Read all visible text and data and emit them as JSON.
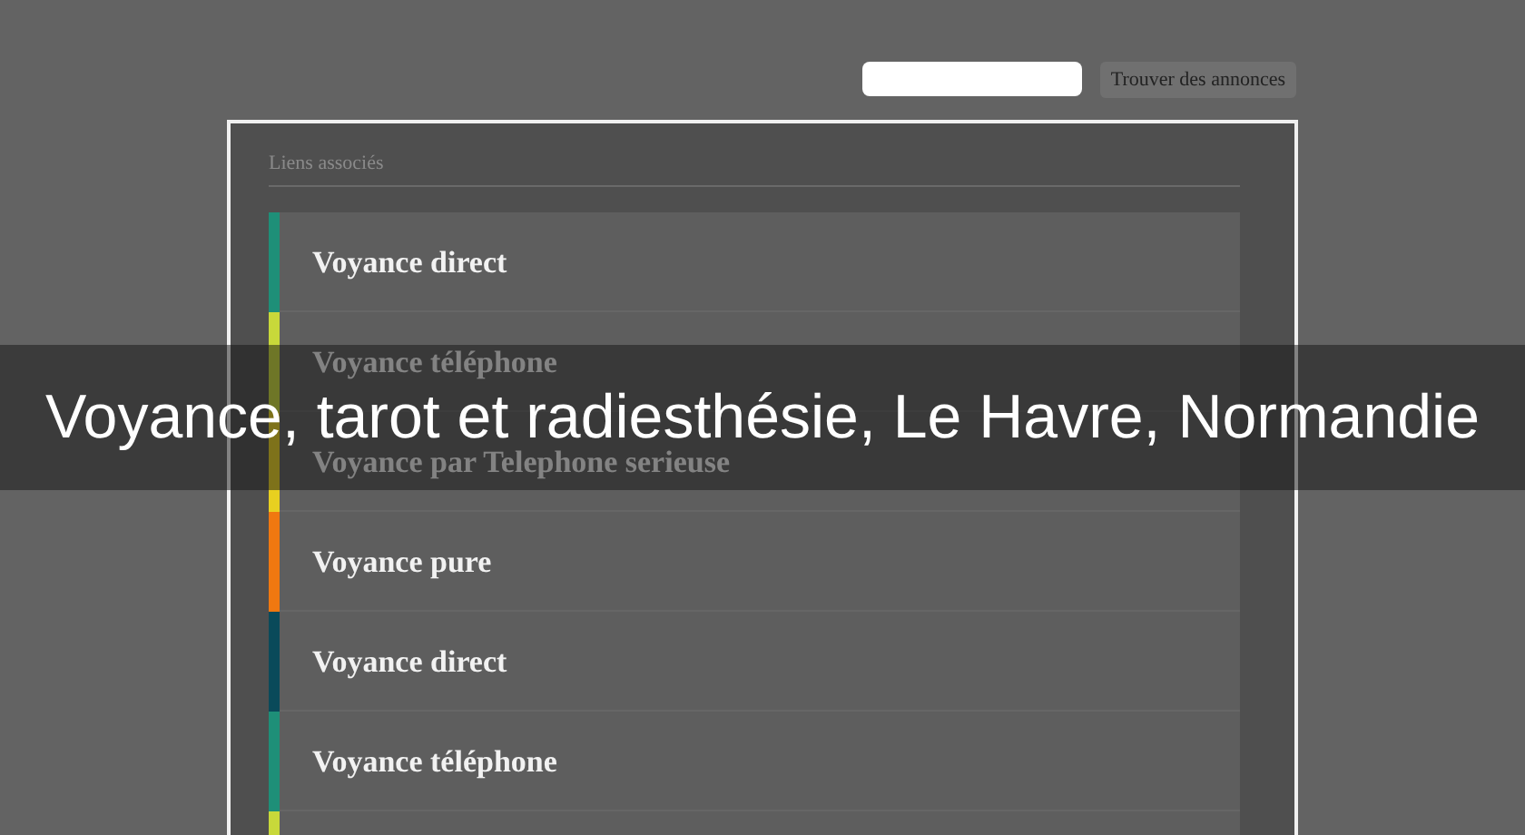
{
  "search": {
    "button": "Trouver des annonces"
  },
  "links": {
    "heading": "Liens associés",
    "items": [
      {
        "label": "Voyance direct",
        "color": "#1e8f78"
      },
      {
        "label": "Voyance téléphone",
        "color": "#c8d83a"
      },
      {
        "label": "Voyance par Telephone serieuse",
        "color": "#e8d020"
      },
      {
        "label": "Voyance pure",
        "color": "#f07810"
      },
      {
        "label": "Voyance direct",
        "color": "#0a4a5a"
      },
      {
        "label": "Voyance téléphone",
        "color": "#1e8f78"
      },
      {
        "color": "#c8d83a"
      }
    ]
  },
  "banner": {
    "title": "Voyance, tarot et radiesthésie, Le Havre, Normandie"
  }
}
